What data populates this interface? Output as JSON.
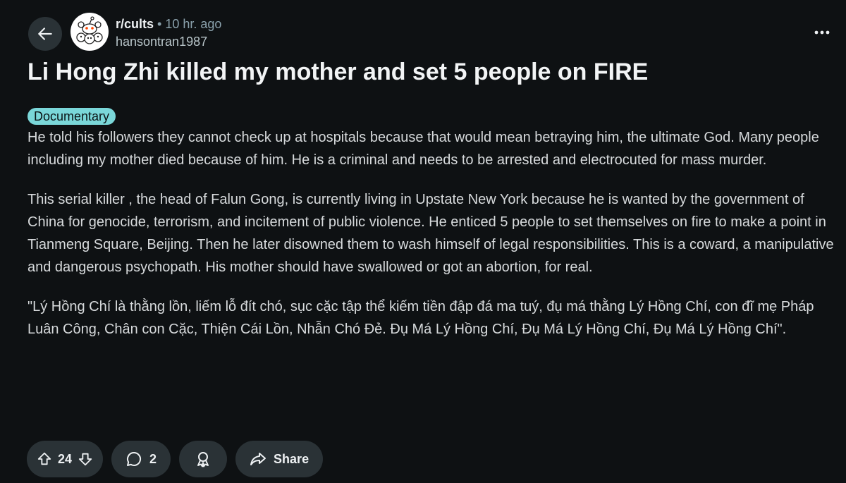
{
  "header": {
    "subreddit": "r/cults",
    "separator": "•",
    "time": "10 hr. ago",
    "author": "hansontran1987"
  },
  "post": {
    "title": "Li Hong Zhi killed my mother and set 5 people on FIRE",
    "flair": "Documentary",
    "paragraphs": [
      "He told his followers they cannot check up at hospitals because that would mean betraying him, the ultimate God. Many people including my mother died because of him. He is a criminal and needs to be arrested and electrocuted for mass murder.",
      "This serial killer , the head of Falun Gong, is currently living in Upstate New York because he is wanted by the government of China for genocide, terrorism, and incitement of public violence. He enticed 5 people to set themselves on fire to make a point in Tianmeng Square, Beijing. Then he later disowned them to wash himself of legal responsibilities. This is a coward, a manipulative and dangerous psychopath. His mother should have swallowed or got an abortion, for real.",
      "\"Lý Hồng Chí là thằng lồn, liếm lỗ đít chó, sục cặc tập thể kiếm tiền đập đá ma tuý, đụ má thằng Lý Hồng Chí, con đĩ mẹ Pháp Luân Công, Chân con Cặc, Thiện Cái Lồn, Nhẫn Chó Đẻ. Đụ Má Lý Hồng Chí, Đụ Má Lý Hồng Chí, Đụ Má Lý Hồng Chí\"."
    ]
  },
  "actions": {
    "votes": "24",
    "comments": "2",
    "share_label": "Share"
  },
  "icons": {
    "back": "arrow-left-icon",
    "avatar": "reddit-snoo-icon",
    "more": "more-horizontal-icon",
    "upvote": "upvote-arrow-icon",
    "downvote": "downvote-arrow-icon",
    "comment": "comment-bubble-icon",
    "award": "award-icon",
    "share": "share-arrow-icon"
  },
  "colors": {
    "background": "#0e1113",
    "button": "#2a3236",
    "flair": "#7ad7d9",
    "text": "#eef1f3",
    "muted": "#8ba2ad"
  }
}
